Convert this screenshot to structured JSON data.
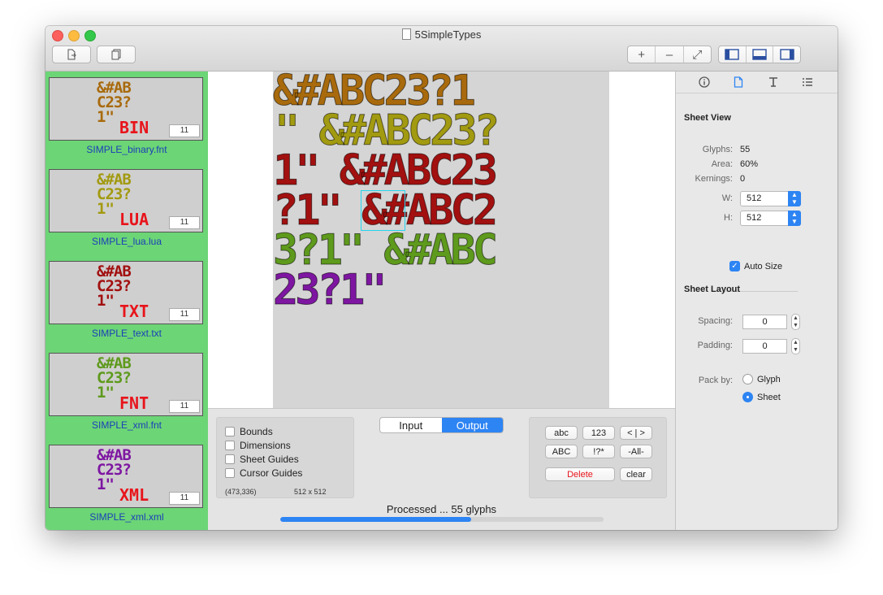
{
  "window": {
    "title": "5SimpleTypes"
  },
  "toolbar": {
    "new_icon": "new-document-icon",
    "duplicate_icon": "duplicate-icon",
    "zoom_in": "+",
    "zoom_out": "–",
    "zoom_fit": "⤢",
    "view_icons": [
      "left-sidebar-icon",
      "bottom-panel-icon",
      "right-sidebar-icon"
    ]
  },
  "font_list": [
    {
      "glyphs": "&#AB\nC23?\n1\"",
      "label": "BIN",
      "count": "11",
      "filename": "SIMPLE_binary.fnt",
      "color": "#a86a0c"
    },
    {
      "glyphs": "&#AB\nC23?\n1\"",
      "label": "LUA",
      "count": "11",
      "filename": "SIMPLE_lua.lua",
      "color": "#a29a10"
    },
    {
      "glyphs": "&#AB\nC23?\n1\"",
      "label": "TXT",
      "count": "11",
      "filename": "SIMPLE_text.txt",
      "color": "#a21010"
    },
    {
      "glyphs": "&#AB\nC23?\n1\"",
      "label": "FNT",
      "count": "11",
      "filename": "SIMPLE_xml.fnt",
      "color": "#5e9a1c"
    },
    {
      "glyphs": "&#AB\nC23?\n1\"",
      "label": "XML",
      "count": "11",
      "filename": "SIMPLE_xml.xml",
      "color": "#7e16a2"
    }
  ],
  "sheet_rows": [
    {
      "text": "&#ABC23?1",
      "color": "#a86a0c"
    },
    {
      "text": "\" &#ABC23?",
      "color": "#a29a10"
    },
    {
      "text": "1\" &#ABC23",
      "color": "#a21010"
    },
    {
      "text": "?1\" &#ABC2",
      "color": "#5e9a1c"
    },
    {
      "text": "3?1\" &#ABC",
      "color": "#7e16a2"
    },
    {
      "text": "23?1\"",
      "color": "#7e16a2"
    }
  ],
  "options": {
    "bounds": "Bounds",
    "dimensions": "Dimensions",
    "sheet_guides": "Sheet Guides",
    "cursor_guides": "Cursor Guides",
    "cursor_pos": "(473,336)",
    "sheet_size": "512 x 512"
  },
  "view_mode": {
    "input": "Input",
    "output": "Output"
  },
  "charset_buttons": {
    "lower": "abc",
    "digits": "123",
    "brackets": "< | >",
    "upper": "ABC",
    "symbols": "!?*",
    "all": "-All-",
    "delete": "Delete",
    "clear": "clear"
  },
  "status": {
    "text": "Processed ... 55 glyphs",
    "progress": 0.59
  },
  "inspector": {
    "tab_icons": [
      "info-icon",
      "document-icon",
      "text-icon",
      "list-icon"
    ],
    "sheet_view": {
      "title": "Sheet View",
      "glyphs_label": "Glyphs:",
      "glyphs": "55",
      "area_label": "Area:",
      "area": "60%",
      "kernings_label": "Kernings:",
      "kernings": "0",
      "w_label": "W:",
      "w": "512",
      "h_label": "H:",
      "h": "512",
      "auto_size": "Auto Size"
    },
    "sheet_layout": {
      "title": "Sheet Layout",
      "spacing_label": "Spacing:",
      "spacing": "0",
      "padding_label": "Padding:",
      "padding": "0",
      "pack_label": "Pack by:",
      "glyph": "Glyph",
      "sheet": "Sheet"
    }
  },
  "colors": {
    "accent": "#2d84f3",
    "list_bg": "#6cd576",
    "delete_text": "#e8141b"
  }
}
